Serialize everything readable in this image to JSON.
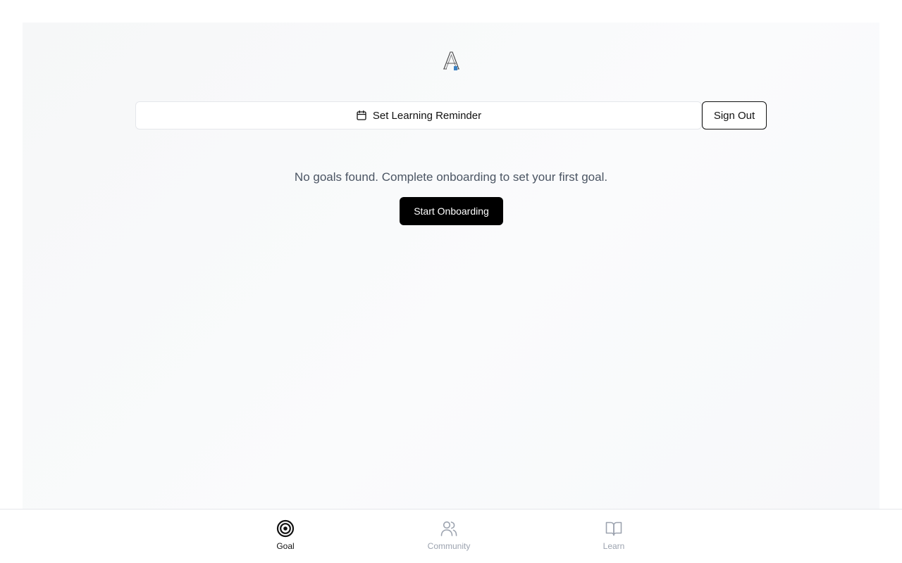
{
  "header": {
    "logo_icon": "app-logo-icon"
  },
  "toolbar": {
    "reminder_label": "Set Learning Reminder",
    "reminder_icon": "calendar-icon",
    "signout_label": "Sign Out"
  },
  "main": {
    "empty_message": "No goals found. Complete onboarding to set your first goal.",
    "onboarding_label": "Start Onboarding"
  },
  "bottom_nav": {
    "items": [
      {
        "label": "Goal",
        "icon": "target-icon",
        "active": true
      },
      {
        "label": "Community",
        "icon": "users-icon",
        "active": false
      },
      {
        "label": "Learn",
        "icon": "book-open-icon",
        "active": false
      }
    ]
  },
  "colors": {
    "primary": "#000000",
    "muted_text": "#4b5563",
    "inactive_nav": "#9ca3af",
    "border": "#e5e7eb"
  }
}
